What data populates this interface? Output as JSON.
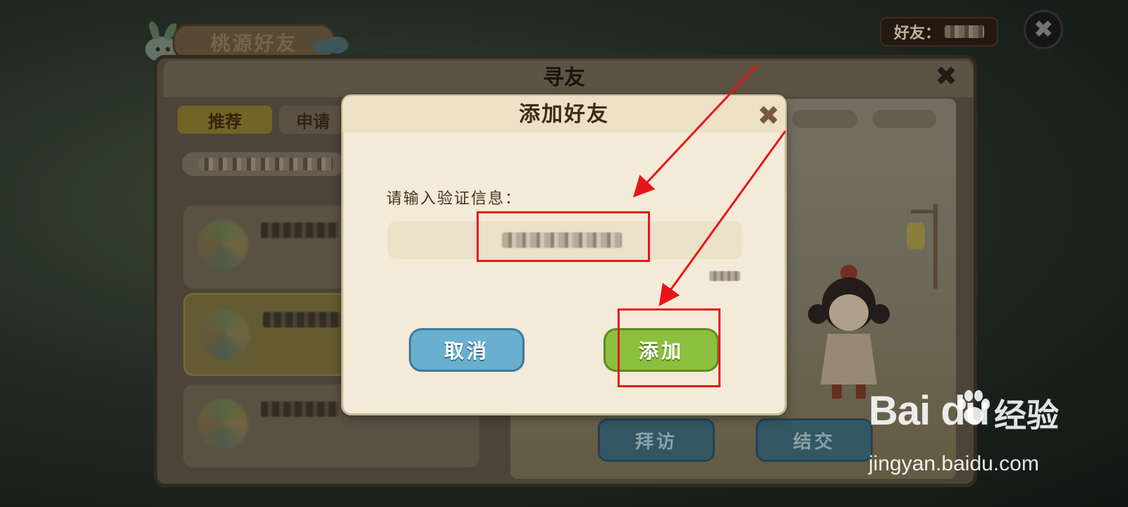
{
  "background": {
    "title_tag": "桃源好友",
    "friend_count_label": "好友：",
    "panel_title": "寻友",
    "tabs": [
      {
        "label": "推荐",
        "selected": true
      },
      {
        "label": "申请",
        "selected": false
      }
    ],
    "scene_buttons": {
      "visit": "拜访",
      "befriend": "结交"
    }
  },
  "dialog": {
    "title": "添加好友",
    "prompt": "请输入验证信息：",
    "cancel_label": "取消",
    "add_label": "添加"
  },
  "watermark": {
    "logo": "Bai du",
    "cn": "经验",
    "url": "jingyan.baidu.com"
  },
  "colors": {
    "annotation_red": "#e8141a",
    "cancel_blue": "#6aaed0",
    "add_green": "#8cbf3e",
    "dialog_bg": "#f3ead7"
  },
  "icons": [
    "close-icon",
    "bunny-icon",
    "paw-icon",
    "avatar"
  ]
}
